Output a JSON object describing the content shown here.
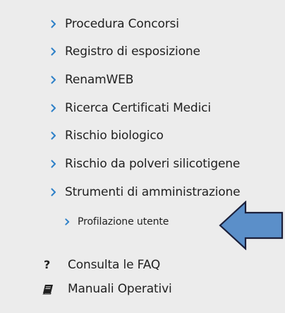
{
  "menu": {
    "items": [
      {
        "label": "Procedura Concorsi"
      },
      {
        "label": "Registro di esposizione"
      },
      {
        "label": "RenamWEB"
      },
      {
        "label": "Ricerca Certificati Medici"
      },
      {
        "label": "Rischio biologico"
      },
      {
        "label": "Rischio da polveri silicotigene"
      },
      {
        "label": "Strumenti di amministrazione"
      }
    ],
    "sub_items": [
      {
        "label": "Profilazione utente"
      }
    ]
  },
  "links": [
    {
      "label": "Consulta le FAQ",
      "icon": "question-icon"
    },
    {
      "label": "Manuali Operativi",
      "icon": "book-icon"
    }
  ],
  "colors": {
    "background": "#ececec",
    "text": "#1f1f1f",
    "chevron": "#2f81c8",
    "arrow_fill": "#5b8fc9",
    "arrow_stroke": "#1b1f3a"
  },
  "annotation": {
    "icon": "left-arrow-callout"
  }
}
